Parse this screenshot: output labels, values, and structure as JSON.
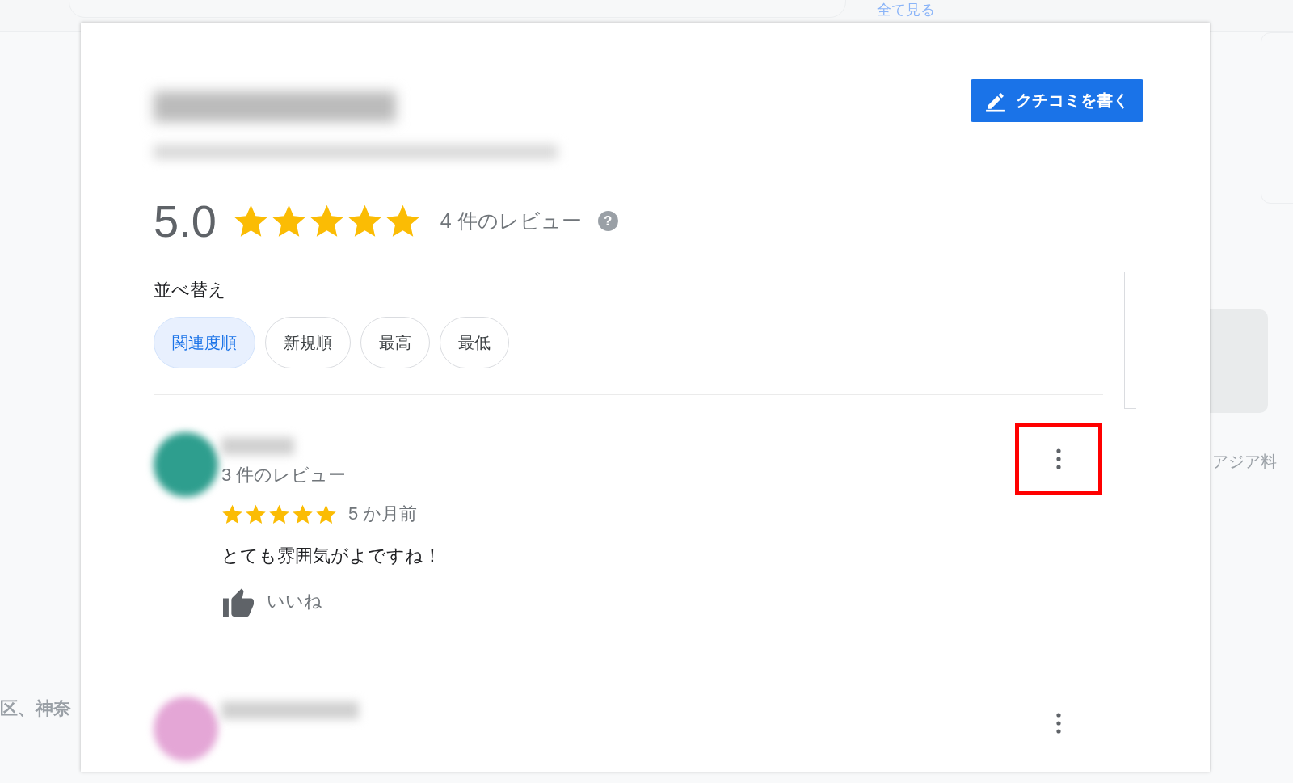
{
  "background": {
    "see_all_link": "全て見る",
    "side_texts": [
      "区、神奈",
      "アジア料"
    ]
  },
  "dialog": {
    "write_review_button": "クチコミを書く",
    "rating": {
      "score": "5.0",
      "stars": 5,
      "review_count": "4 件のレビュー",
      "help_icon": "?"
    },
    "sort": {
      "label": "並べ替え",
      "options": [
        {
          "label": "関連度順",
          "selected": true
        },
        {
          "label": "新規順",
          "selected": false
        },
        {
          "label": "最高",
          "selected": false
        },
        {
          "label": "最低",
          "selected": false
        }
      ]
    },
    "reviews": [
      {
        "reviewer_reviews": "3 件のレビュー",
        "stars": 5,
        "time": "5 か月前",
        "text": "とても雰囲気がよですね！",
        "like_label": "いいね",
        "menu_highlighted": true
      },
      {
        "menu_highlighted": false
      }
    ]
  }
}
